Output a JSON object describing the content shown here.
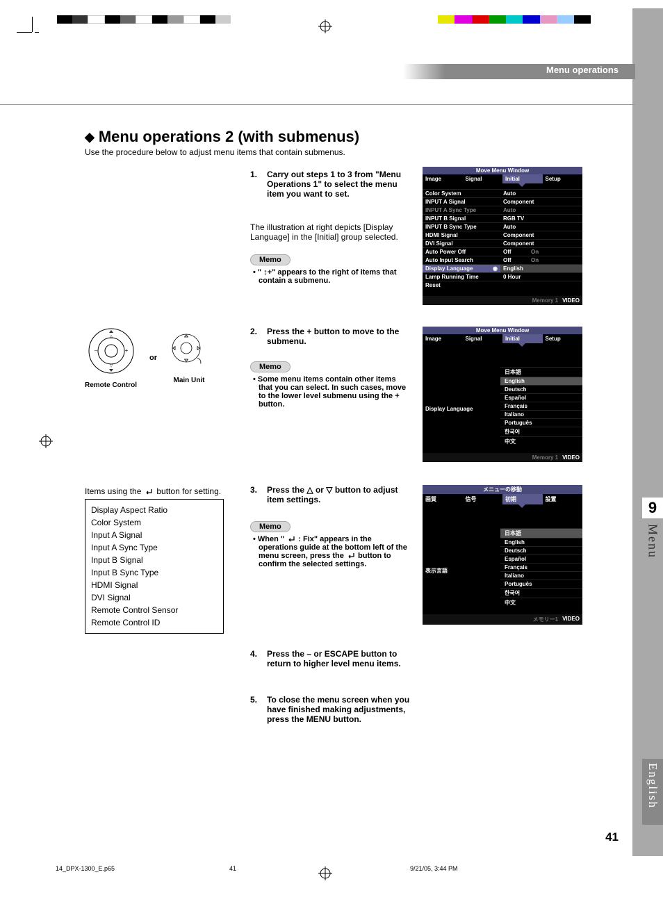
{
  "header": {
    "section": "Menu operations"
  },
  "title": {
    "text": "Menu operations 2 (with submenus)"
  },
  "subtitle": "Use the procedure below to adjust menu items that contain submenus.",
  "steps": {
    "s1": {
      "num": "1.",
      "text": "Carry out steps 1 to 3 from \"Menu Operations 1\" to select the menu item you want to set."
    },
    "s1b": "The illustration at right depicts [Display Language] in the [Initial] group selected.",
    "memo_label": "Memo",
    "m1": "\" ↕+\" appears to the right of items that contain a submenu.",
    "s2": {
      "num": "2.",
      "text": "Press the + button to move to the submenu."
    },
    "m2": "Some menu items contain other items that you can select. In such cases, move to the lower level submenu using the + button.",
    "s3": {
      "num": "3.",
      "text_a": "Press the ",
      "text_b": " or ",
      "text_c": " button to adjust item settings."
    },
    "m3a": "When \" ",
    "m3b": " : Fix\" appears in the operations guide at the bottom left of the menu screen, press the ",
    "m3c": " button to confirm the selected settings.",
    "s4": {
      "num": "4.",
      "text": "Press the – or ESCAPE button to return to higher level menu items."
    },
    "s5": {
      "num": "5.",
      "text": "To close the menu screen when you have finished making adjustments, press the MENU button."
    }
  },
  "controls": {
    "or": "or",
    "remote": "Remote Control",
    "main": "Main Unit"
  },
  "items_intro_a": "Items using the ",
  "items_intro_b": " button for setting.",
  "items_list": [
    "Display Aspect Ratio",
    "Color System",
    "Input A Signal",
    "Input A Sync Type",
    "Input B Signal",
    "Input B Sync Type",
    "HDMI Signal",
    "DVI Signal",
    "Remote Control Sensor",
    "Remote Control ID"
  ],
  "osd1": {
    "move": "Move Menu Window",
    "tabs": [
      "Image",
      "Signal",
      "Initial",
      "Setup"
    ],
    "rows": [
      {
        "l": "Color System",
        "r": "Auto"
      },
      {
        "l": "INPUT A Signal",
        "r": "Component"
      },
      {
        "l": "INPUT A Sync Type",
        "r": "Auto",
        "dim": true
      },
      {
        "l": "INPUT B Signal",
        "r": "RGB TV"
      },
      {
        "l": "INPUT B Sync Type",
        "r": "Auto"
      },
      {
        "l": "HDMI Signal",
        "r": "Component"
      },
      {
        "l": "DVI Signal",
        "r": "Component"
      },
      {
        "l": "Auto Power Off",
        "r": "Off",
        "r2": "On"
      },
      {
        "l": "Auto Input Search",
        "r": "Off",
        "r2": "On"
      },
      {
        "l": "Display Language",
        "r": "English",
        "sel": true,
        "cursor": true
      },
      {
        "l": "Lamp Running Time",
        "r": "0 Hour"
      },
      {
        "l": "Reset",
        "r": ""
      }
    ],
    "foot": {
      "mem": "Memory 1",
      "src": "VIDEO"
    }
  },
  "osd2": {
    "move": "Move Menu Window",
    "tabs": [
      "Image",
      "Signal",
      "Initial",
      "Setup"
    ],
    "label": "Display Language",
    "langs": [
      "日本語",
      "English",
      "Deutsch",
      "Español",
      "Français",
      "Italiano",
      "Português",
      "한국어",
      "中文"
    ],
    "sel_idx": 1,
    "foot": {
      "mem": "Memory 1",
      "src": "VIDEO"
    }
  },
  "osd3": {
    "move": "メニューの移動",
    "tabs": [
      "画質",
      "信号",
      "初期",
      "設置"
    ],
    "label": "表示言語",
    "langs": [
      "日本語",
      "English",
      "Deutsch",
      "Español",
      "Français",
      "Italiano",
      "Português",
      "한국어",
      "中文"
    ],
    "sel_idx": 0,
    "foot": {
      "mem": "メモリー1",
      "src": "VIDEO"
    }
  },
  "side": {
    "num": "9",
    "menu": "Menu",
    "english": "English"
  },
  "page_number": "41",
  "footer": {
    "file": "14_DPX-1300_E.p65",
    "page": "41",
    "date": "9/21/05, 3:44 PM"
  }
}
